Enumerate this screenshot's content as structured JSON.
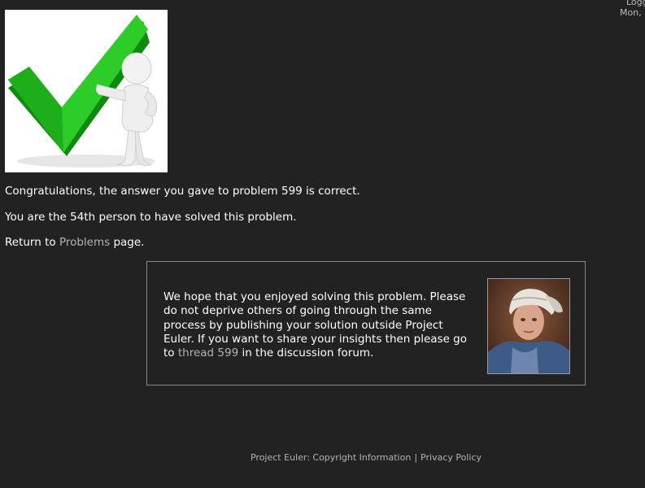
{
  "session": {
    "status_line": "Logg",
    "date_line": "Mon,"
  },
  "result": {
    "image_name": "green-checkmark-figure",
    "congrats_text": "Congratulations, the answer you gave to problem 599 is correct.",
    "solver_text": "You are the 54th person to have solved this problem.",
    "return_prefix": "Return to ",
    "return_link": "Problems",
    "return_suffix": " page."
  },
  "notice": {
    "text_before_link": "We hope that you enjoyed solving this problem. Please do not deprive others of going through the same process by publishing your solution outside Project Euler. If you want to share your insights then please go to ",
    "thread_link": "thread 599",
    "text_after_link": " in the discussion forum.",
    "portrait_name": "euler-portrait"
  },
  "footer": {
    "copyright_link": "Project Euler: Copyright Information",
    "separator": "|",
    "privacy_link": "Privacy Policy"
  },
  "colors": {
    "background": "#222222",
    "link": "#b3b3b3",
    "check_green": "#22b21e"
  }
}
